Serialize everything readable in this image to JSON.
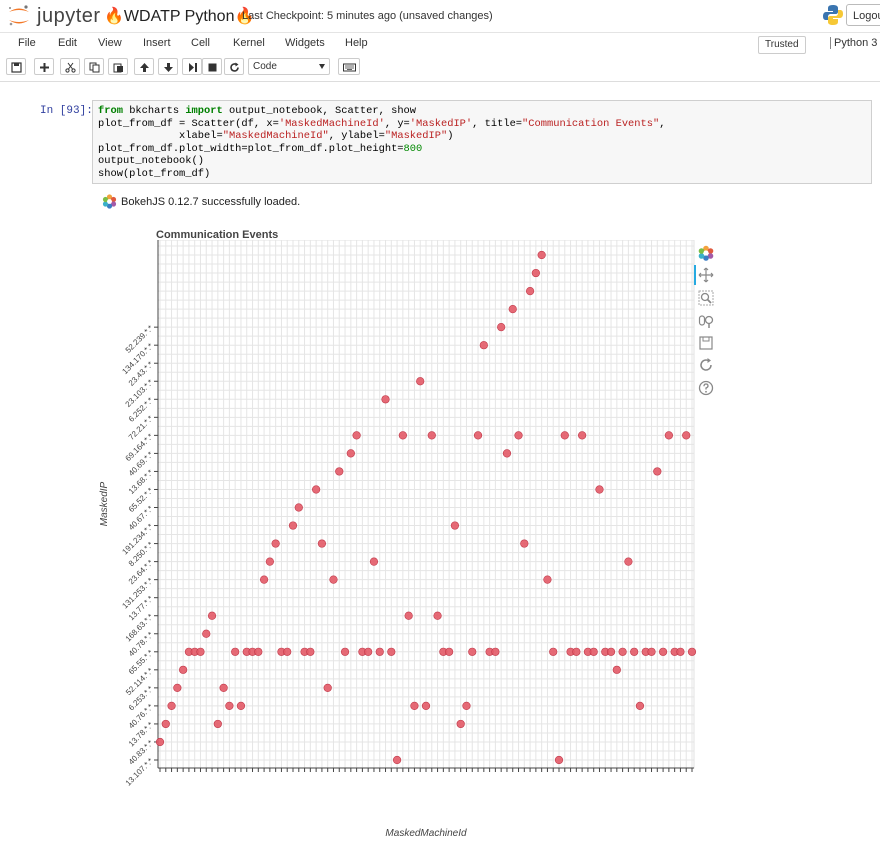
{
  "header": {
    "logo_text": "jupyter",
    "notebook_name": "🔥WDATP Python🔥",
    "checkpoint": "Last Checkpoint: 5 minutes ago (unsaved changes)",
    "logout": "Logout"
  },
  "menu": {
    "items": [
      "File",
      "Edit",
      "View",
      "Insert",
      "Cell",
      "Kernel",
      "Widgets",
      "Help"
    ],
    "trusted": "Trusted",
    "kernel": "Python 3"
  },
  "toolbar": {
    "buttons": [
      "save-icon",
      "plus-icon",
      "cut-icon",
      "copy-icon",
      "paste-icon",
      "arrow-up-icon",
      "arrow-down-icon",
      "step-forward-icon",
      "stop-icon",
      "refresh-icon"
    ],
    "cell_type": "Code",
    "keyboard_icon": "keyboard-icon"
  },
  "cell": {
    "prompt": "In [93]:",
    "code_lines": [
      "from bkcharts import output_notebook, Scatter, show",
      "plot_from_df = Scatter(df, x='MaskedMachineId', y='MaskedIP', title=\"Communication Events\",",
      "             xlabel=\"MaskedMachineId\", ylabel=\"MaskedIP\")",
      "plot_from_df.plot_width=plot_from_df.plot_height=800",
      "output_notebook()",
      "show(plot_from_df)"
    ]
  },
  "output": {
    "bokeh_message": "BokehJS 0.12.7 successfully loaded."
  },
  "colors": {
    "point_fill": "#e35a67",
    "grid": "#e5e5e5",
    "code_keyword": "#008000",
    "code_string": "#ba2121",
    "prompt": "#303f9f"
  },
  "chart_data": {
    "type": "scatter",
    "title": "Communication Events",
    "xlabel": "MaskedMachineId",
    "ylabel": "MaskedIP",
    "y_categories": [
      "13.107.*.*",
      "40.83.*.*",
      "13.78.*.*",
      "40.76.*.*",
      "6.253.*.*",
      "52.114.*.*",
      "65.55.*.*",
      "40.78.*.*",
      "168.63.*.*",
      "13.77.*.*",
      "131.253.*.*",
      "23.64.*.*",
      "8.250.*.*",
      "191.234.*.*",
      "40.67.*.*",
      "65.52.*.*",
      "13.68.*.*",
      "40.69.*.*",
      "69.164.*.*",
      "72.21.*.*",
      "6.252.*.*",
      "23.103.*.*",
      "23.43.*.*",
      "134.170.*.*",
      "52.239.*.*"
    ],
    "x_category_count": 92,
    "x_labels_legible": false,
    "points": [
      [
        0,
        1
      ],
      [
        1,
        2
      ],
      [
        2,
        3
      ],
      [
        3,
        4
      ],
      [
        4,
        5
      ],
      [
        5,
        6
      ],
      [
        6,
        6
      ],
      [
        7,
        6
      ],
      [
        8,
        7
      ],
      [
        9,
        8
      ],
      [
        10,
        2
      ],
      [
        11,
        4
      ],
      [
        12,
        3
      ],
      [
        13,
        6
      ],
      [
        14,
        3
      ],
      [
        15,
        6
      ],
      [
        16,
        6
      ],
      [
        17,
        6
      ],
      [
        18,
        10
      ],
      [
        19,
        11
      ],
      [
        20,
        12
      ],
      [
        21,
        6
      ],
      [
        22,
        6
      ],
      [
        23,
        13
      ],
      [
        24,
        14
      ],
      [
        25,
        6
      ],
      [
        26,
        6
      ],
      [
        27,
        15
      ],
      [
        28,
        12
      ],
      [
        29,
        4
      ],
      [
        30,
        10
      ],
      [
        31,
        16
      ],
      [
        32,
        6
      ],
      [
        33,
        17
      ],
      [
        34,
        18
      ],
      [
        35,
        6
      ],
      [
        36,
        6
      ],
      [
        37,
        11
      ],
      [
        38,
        6
      ],
      [
        39,
        20
      ],
      [
        40,
        6
      ],
      [
        41,
        0
      ],
      [
        42,
        18
      ],
      [
        43,
        8
      ],
      [
        44,
        3
      ],
      [
        45,
        21
      ],
      [
        46,
        3
      ],
      [
        47,
        18
      ],
      [
        48,
        8
      ],
      [
        49,
        6
      ],
      [
        50,
        6
      ],
      [
        51,
        13
      ],
      [
        52,
        2
      ],
      [
        53,
        3
      ],
      [
        54,
        6
      ],
      [
        55,
        18
      ],
      [
        56,
        23
      ],
      [
        57,
        6
      ],
      [
        58,
        6
      ],
      [
        59,
        24
      ],
      [
        60,
        17
      ],
      [
        61,
        25
      ],
      [
        62,
        18
      ],
      [
        63,
        12
      ],
      [
        64,
        26
      ],
      [
        65,
        27
      ],
      [
        66,
        28
      ],
      [
        67,
        10
      ],
      [
        68,
        6
      ],
      [
        69,
        0
      ],
      [
        70,
        18
      ],
      [
        71,
        6
      ],
      [
        72,
        6
      ],
      [
        73,
        18
      ],
      [
        74,
        6
      ],
      [
        75,
        6
      ],
      [
        76,
        15
      ],
      [
        77,
        6
      ],
      [
        78,
        6
      ],
      [
        79,
        5
      ],
      [
        80,
        6
      ],
      [
        81,
        11
      ],
      [
        82,
        6
      ],
      [
        83,
        3
      ],
      [
        84,
        6
      ],
      [
        85,
        6
      ],
      [
        86,
        16
      ],
      [
        87,
        6
      ],
      [
        88,
        18
      ],
      [
        89,
        6
      ],
      [
        90,
        6
      ],
      [
        91,
        18
      ],
      [
        92,
        6
      ]
    ],
    "grid": true
  }
}
